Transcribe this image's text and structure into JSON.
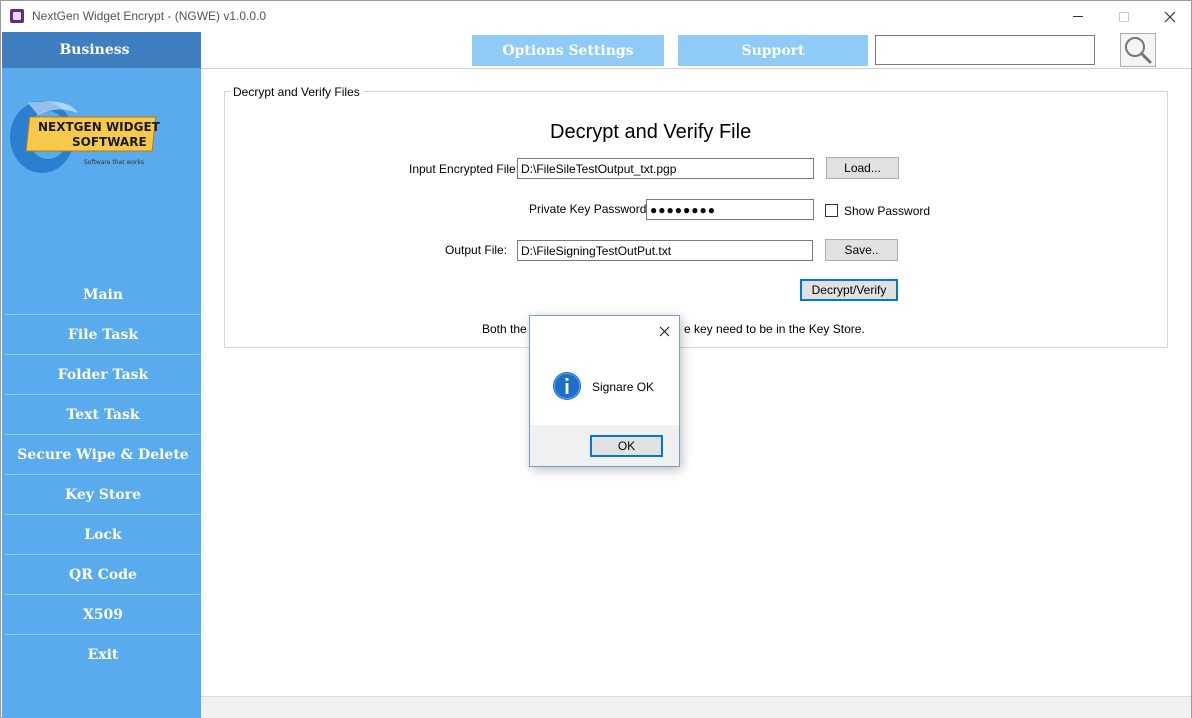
{
  "window": {
    "title": "NextGen Widget Encrypt - (NGWE) v1.0.0.0"
  },
  "sidebar": {
    "header": "Business",
    "logo": {
      "line1": "NEXTGEN WIDGET",
      "line2": "SOFTWARE",
      "tagline": "Software that works"
    },
    "items": [
      {
        "label": "Main"
      },
      {
        "label": "File Task"
      },
      {
        "label": "Folder Task"
      },
      {
        "label": "Text Task"
      },
      {
        "label": "Secure Wipe & Delete"
      },
      {
        "label": "Key Store"
      },
      {
        "label": "Lock"
      },
      {
        "label": "QR Code"
      },
      {
        "label": "X509"
      },
      {
        "label": "Exit"
      }
    ]
  },
  "topbar": {
    "options_label": "Options Settings",
    "support_label": "Support",
    "search_value": ""
  },
  "form": {
    "group_title": "Decrypt and Verify Files",
    "title": "Decrypt and Verify File",
    "input_label": "Input Encrypted File:",
    "input_value": "D:\\FileSileTestOutput_txt.pgp",
    "load_label": "Load...",
    "password_label": "Private Key Password:",
    "password_value": "●●●●●●●●",
    "show_password_label": "Show Password",
    "show_password_checked": false,
    "output_label": "Output File:",
    "output_value": "D:\\FileSigningTestOutPut.txt",
    "save_label": "Save..",
    "decrypt_label": "Decrypt/Verify",
    "note_left": "Both the re",
    "note_right": "e key need to be in the Key Store."
  },
  "dialog": {
    "message": "Signare OK",
    "ok_label": "OK",
    "icon": "info-icon"
  },
  "colors": {
    "sidebar": "#5aabee",
    "sidebar_header": "#3f7fbf",
    "top_buttons": "#8fcbf6",
    "focus": "#0078d7"
  }
}
